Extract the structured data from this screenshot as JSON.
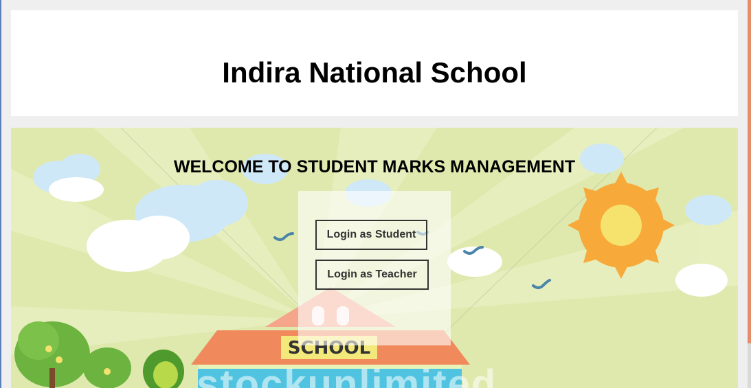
{
  "header": {
    "title": "Indira National School"
  },
  "hero": {
    "welcome": "WELCOME TO STUDENT MARKS MANAGEMENT",
    "school_sign": "SCHOOL",
    "watermark": "stockunlimited"
  },
  "login": {
    "student_label": "Login as Student",
    "teacher_label": "Login as Teacher"
  },
  "colors": {
    "page_bg": "#efefef",
    "hero_bg": "#dfe9ad",
    "sun": "#f7a93a",
    "sky_cloud": "#cfe8f7",
    "roof": "#f08a5d",
    "building": "#4fc3e0"
  }
}
